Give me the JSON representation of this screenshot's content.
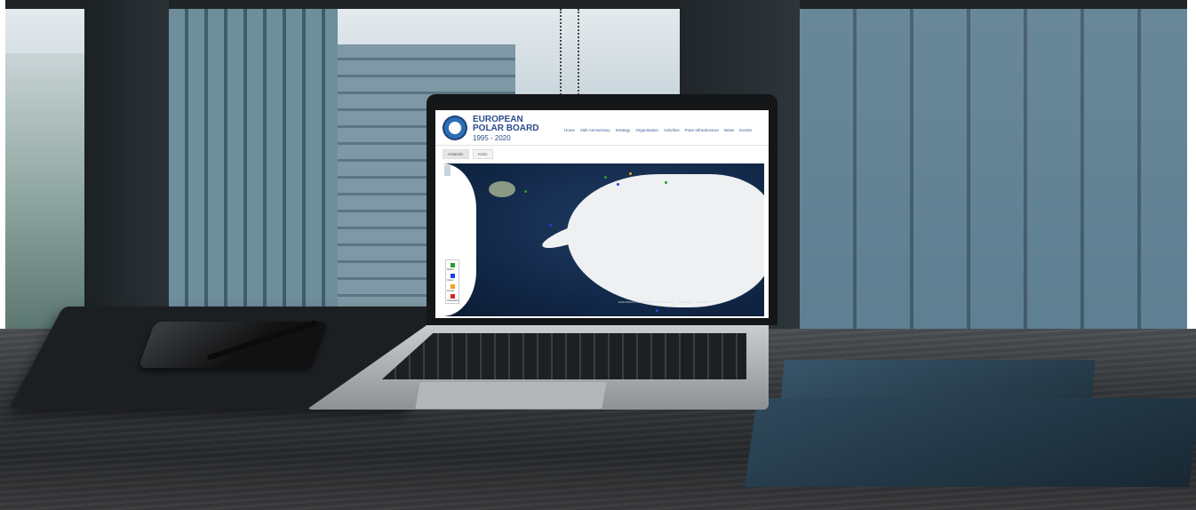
{
  "site": {
    "logo_line1": "EUROPEAN",
    "logo_line2": "POLAR BOARD",
    "logo_years": "1995 - 2020"
  },
  "nav": [
    "Home",
    "25th Anniversary",
    "Strategy",
    "Organisation",
    "Activities",
    "Polar Infrastructure",
    "News",
    "Events"
  ],
  "tabs": [
    {
      "label": "Antarctic",
      "active": true
    },
    {
      "label": "Arctic",
      "active": false
    }
  ],
  "legend": [
    {
      "label": "Station",
      "color": "#2e9a2e"
    },
    {
      "label": "Vessel",
      "color": "#1f3fe0"
    },
    {
      "label": "Aircraft",
      "color": "#f0a020"
    },
    {
      "label": "Observatory",
      "color": "#e02020"
    }
  ],
  "partners": [
    "EUROPEAN POLAR BOARD",
    "EU-PolarNet",
    "COMNAP",
    "INTERACT"
  ],
  "colors": {
    "ocean": "#122848",
    "ice": "#eef0f2",
    "brand_blue": "#2b4b8a"
  }
}
